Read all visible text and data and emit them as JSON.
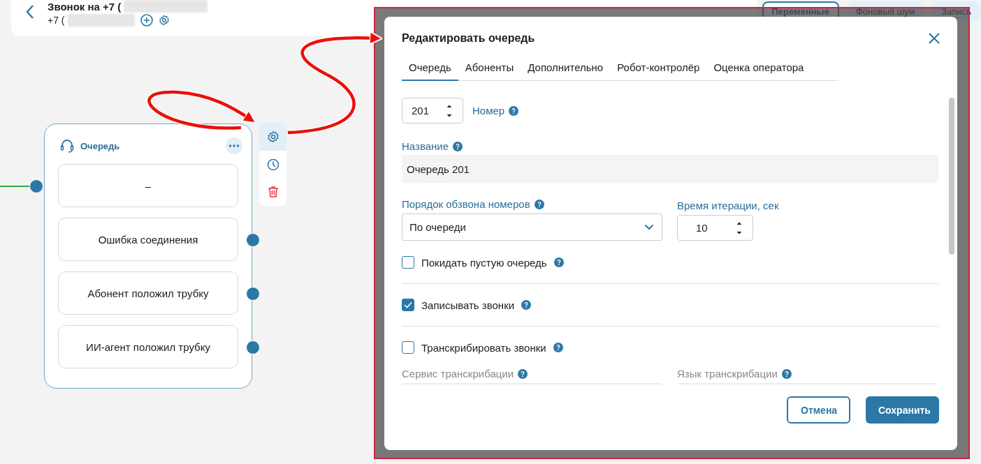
{
  "header": {
    "title": "Звонок на +7 (",
    "subtitle": "+7 ("
  },
  "top_buttons": [
    {
      "label": "Переменные",
      "selected": true
    },
    {
      "label": "Фоновый шум",
      "selected": false
    },
    {
      "label": "Запись",
      "selected": false
    }
  ],
  "node": {
    "title": "Очередь",
    "rows": [
      {
        "label": "–",
        "kind": "input"
      },
      {
        "label": "Ошибка соединения",
        "kind": "output"
      },
      {
        "label": "Абонент положил трубку",
        "kind": "output"
      },
      {
        "label": "ИИ-агент положил трубку",
        "kind": "output"
      }
    ]
  },
  "dialog": {
    "title": "Редактировать очередь",
    "tabs": [
      {
        "label": "Очередь",
        "selected": true
      },
      {
        "label": "Абоненты",
        "selected": false
      },
      {
        "label": "Дополнительно",
        "selected": false
      },
      {
        "label": "Робот-контролёр",
        "selected": false
      },
      {
        "label": "Оценка оператора",
        "selected": false
      }
    ],
    "number": {
      "value": "201",
      "label": "Номер"
    },
    "name": {
      "label": "Название",
      "value": "Очередь 201"
    },
    "dial_order": {
      "label": "Порядок обзвона номеров",
      "value": "По очереди"
    },
    "iteration": {
      "label": "Время итерации, сек",
      "value": "10"
    },
    "options": [
      {
        "label": "Покидать пустую очередь",
        "checked": false
      },
      {
        "label": "Записывать звонки",
        "checked": true
      },
      {
        "label": "Транскрибировать звонки",
        "checked": false
      }
    ],
    "transcription": [
      {
        "label": "Сервис транскрибации",
        "disabled": true
      },
      {
        "label": "Язык транскрибации",
        "disabled": true
      }
    ],
    "buttons": [
      {
        "label": "Отмена",
        "kind": "secondary"
      },
      {
        "label": "Сохранить",
        "kind": "primary"
      }
    ]
  }
}
